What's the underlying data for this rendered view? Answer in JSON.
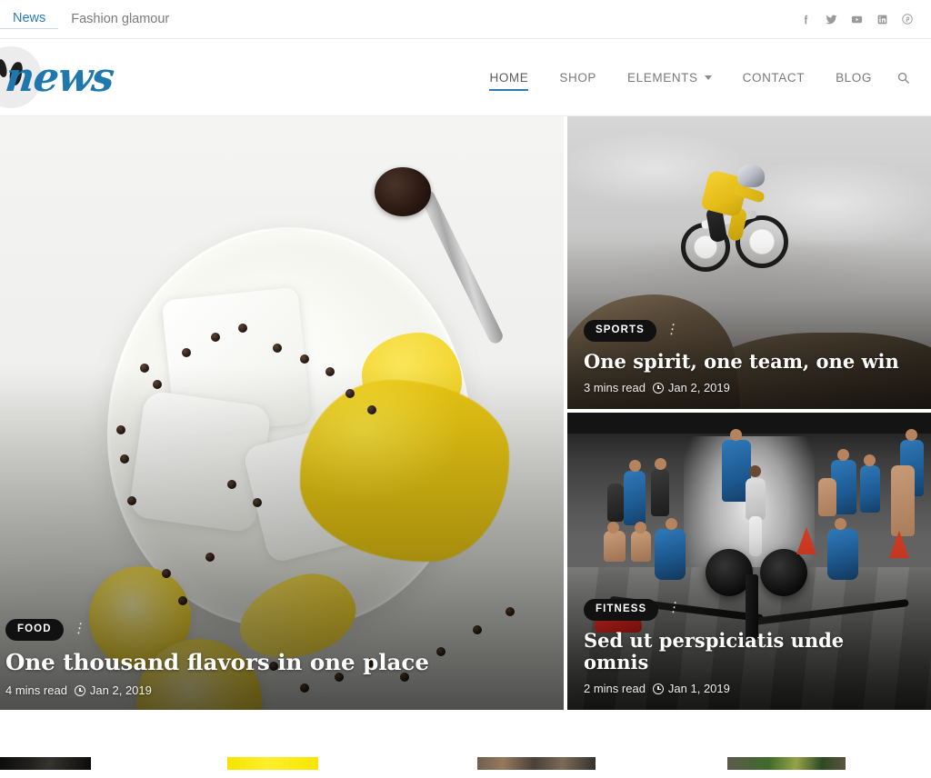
{
  "topbar": {
    "links": [
      {
        "label": "News",
        "active": true
      },
      {
        "label": "Fashion glamour",
        "active": false
      }
    ],
    "social": [
      {
        "name": "facebook-icon",
        "label": "Facebook"
      },
      {
        "name": "twitter-icon",
        "label": "Twitter"
      },
      {
        "name": "youtube-icon",
        "label": "YouTube"
      },
      {
        "name": "linkedin-icon",
        "label": "LinkedIn"
      },
      {
        "name": "pinterest-icon",
        "label": "Pinterest"
      }
    ]
  },
  "header": {
    "logo_text": "news",
    "nav": [
      {
        "label": "HOME",
        "active": true,
        "has_caret": false
      },
      {
        "label": "SHOP",
        "active": false,
        "has_caret": false
      },
      {
        "label": "ELEMENTS",
        "active": false,
        "has_caret": true
      },
      {
        "label": "CONTACT",
        "active": false,
        "has_caret": false
      },
      {
        "label": "BLOG",
        "active": false,
        "has_caret": false
      }
    ],
    "search_label": "Search"
  },
  "hero": {
    "featured": {
      "category": "FOOD",
      "title": "One thousand flavors in one place",
      "read_time": "4 mins read",
      "date": "Jan 2, 2019",
      "image_alt": "cocktail-glass-with-ice-lemon-and-peppercorns"
    },
    "secondary": [
      {
        "category": "SPORTS",
        "title": "One spirit, one team, one win",
        "read_time": "3 mins read",
        "date": "Jan 2, 2019",
        "image_alt": "mountain-biker-jumping-against-gray-sky"
      },
      {
        "category": "FITNESS",
        "title": "Sed ut perspiciatis unde omnis",
        "read_time": "2 mins read",
        "date": "Jan 1, 2019",
        "image_alt": "gym-interior-with-rowing-machines-and-athletes"
      }
    ]
  },
  "thumb_strip": {
    "items": [
      {
        "alt": "dark-thumbnail"
      },
      {
        "alt": "yellow-thumbnail"
      },
      {
        "alt": "warm-brown-thumbnail"
      },
      {
        "alt": "green-landscape-thumbnail"
      }
    ]
  },
  "colors": {
    "accent_blue": "#2c7cb8",
    "badge_black": "#111111",
    "muted_text": "#7a7a7a"
  }
}
